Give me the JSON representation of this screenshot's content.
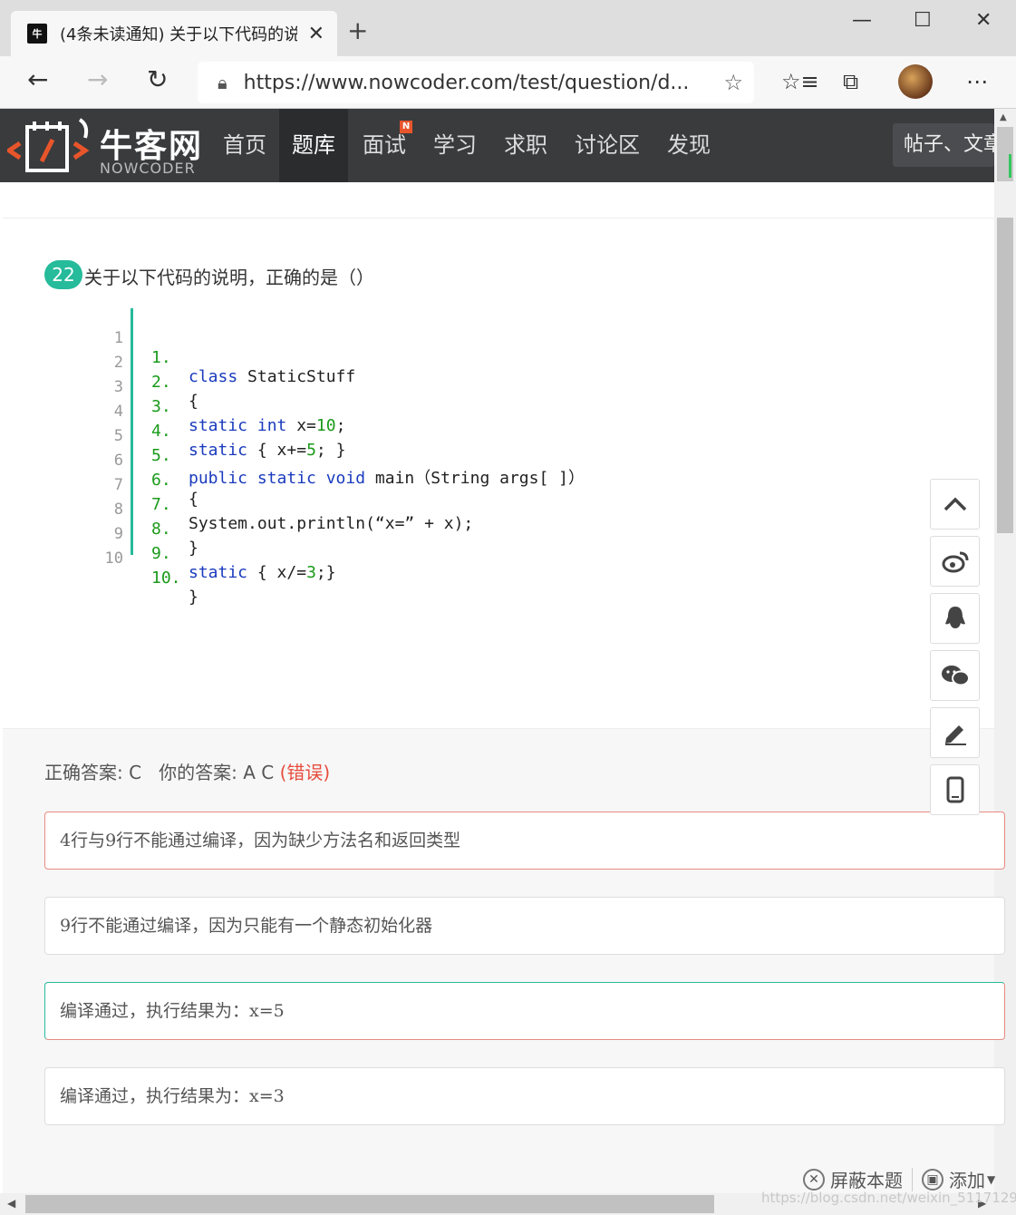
{
  "browser": {
    "tab_title": "(4条未读通知) 关于以下代码的说",
    "favicon_text": "牛",
    "url": "https://www.nowcoder.com/test/question/d..."
  },
  "site": {
    "logo_cn": "牛客网",
    "logo_en": "NOWCODER",
    "nav": [
      "首页",
      "题库",
      "面试",
      "学习",
      "求职",
      "讨论区",
      "发现"
    ],
    "active_nav": "题库",
    "badge": "N",
    "search_placeholder": "帖子、文章"
  },
  "question": {
    "number": "22",
    "title": "关于以下代码的说明，正确的是（）",
    "code_lines": [
      {
        "ln": "1",
        "num": "1.",
        "code": "class StaticStuff"
      },
      {
        "ln": "2",
        "num": "2.",
        "code": "{"
      },
      {
        "ln": "3",
        "num": "3.",
        "code": "static int x=10;"
      },
      {
        "ln": "4",
        "num": "4.",
        "code": "static { x+=5; }"
      },
      {
        "ln": "5",
        "num": "5.",
        "code": "public static void main（String args[ ]）"
      },
      {
        "ln": "6",
        "num": "6.",
        "code": "{"
      },
      {
        "ln": "7",
        "num": "7.",
        "code": "System.out.println(“x=” + x);"
      },
      {
        "ln": "8",
        "num": "8.",
        "code": "}"
      },
      {
        "ln": "9",
        "num": "9.",
        "code": "static { x/=3;}"
      },
      {
        "ln": "10",
        "num": "10.",
        "code": "}"
      }
    ]
  },
  "answer": {
    "correct_label": "正确答案: C",
    "your_label": "你的答案: A C",
    "status": "(错误)"
  },
  "options": [
    "4行与9行不能通过编译，因为缺少方法名和返回类型",
    "9行不能通过编译，因为只能有一个静态初始化器",
    "编译通过，执行结果为：x=5",
    "编译通过，执行结果为：x=3"
  ],
  "bottom": {
    "hide_label": "屏蔽本题",
    "add_label": "添加"
  },
  "watermark": "https://blog.csdn.net/weixin_5117129",
  "colors": {
    "accent": "#25bb9b",
    "error": "#e74c3c",
    "header_bg": "#3a3b3d"
  }
}
